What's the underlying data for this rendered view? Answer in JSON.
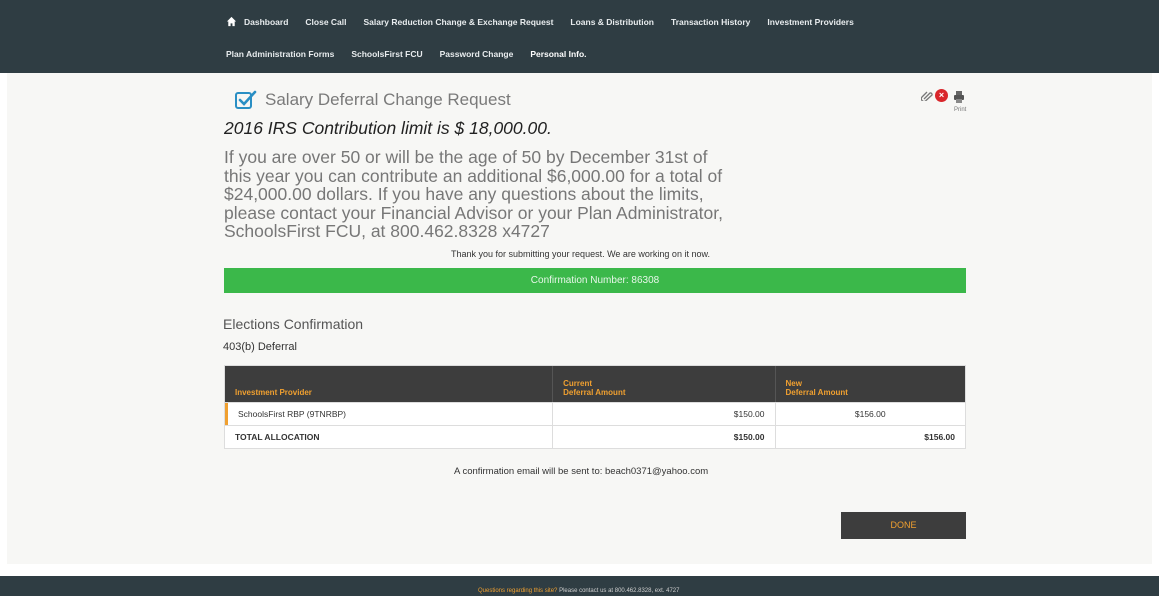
{
  "nav": {
    "row1": [
      "Dashboard",
      "Close Call",
      "Salary Reduction Change & Exchange Request",
      "Loans & Distribution",
      "Transaction History",
      "Investment Providers"
    ],
    "row2": [
      "Plan Administration Forms",
      "SchoolsFirst FCU",
      "Password Change",
      "Personal Info."
    ]
  },
  "page": {
    "title": "Salary Deferral Change Request",
    "irs_limit": "2016 IRS Contribution limit is $ 18,000.00.",
    "info_text": "If you are over 50 or will be the age of 50 by December 31st of this year you can contribute an additional $6,000.00 for a total of $24,000.00 dollars. If you have any questions about the limits, please contact your Financial Advisor or your Plan Administrator, SchoolsFirst FCU, at 800.462.8328 x4727",
    "thanks": "Thank you for submitting your request. We are working on it now.",
    "confirmation": "Confirmation Number: 86308",
    "elections_title": "Elections Confirmation",
    "deferral_label": "403(b) Deferral",
    "email_note": "A confirmation email will be sent to: beach0371@yahoo.com",
    "done_label": "DONE",
    "print_label": "Print"
  },
  "table": {
    "headers": [
      "Investment Provider",
      "Current\nDeferral Amount",
      "New\nDeferral Amount"
    ],
    "provider_row": [
      "SchoolsFirst RBP (9TNRBP)",
      "$150.00",
      "$156.00"
    ],
    "total_row": [
      "TOTAL ALLOCATION",
      "$150.00",
      "$156.00"
    ]
  },
  "footer": {
    "question": "Questions regarding this site?",
    "contact": "Please contact us at 800.462.8328, ext. 4727"
  }
}
